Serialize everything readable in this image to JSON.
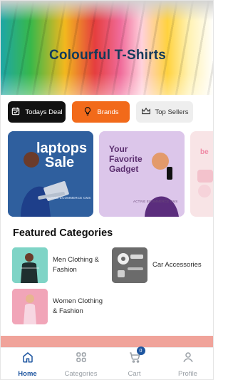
{
  "hero": {
    "title": "Colourful T-Shirts"
  },
  "chips": [
    {
      "label": "Todays Deal",
      "icon": "calendar-check-icon",
      "color": "#111111"
    },
    {
      "label": "Brands",
      "icon": "lightbulb-icon",
      "color": "#f26a1a"
    },
    {
      "label": "Top Sellers",
      "icon": "crown-icon",
      "color": "#eeeeee"
    }
  ],
  "banners": [
    {
      "line1": "laptops",
      "line2": "Sale",
      "small": "ACTIVE ECOMMERCE CMS"
    },
    {
      "line1": "Your",
      "line2": "Favorite",
      "line3": "Gadget",
      "small": "ACTIVE ECOMMERCE CMS"
    },
    {
      "line1": "be"
    }
  ],
  "featured": {
    "title": "Featured Categories",
    "items": [
      {
        "label": "Men Clothing & Fashion"
      },
      {
        "label": "Car Accessories"
      },
      {
        "label": "Women Clothing & Fashion"
      }
    ]
  },
  "bottom_nav": {
    "items": [
      {
        "label": "Home",
        "icon": "home-icon",
        "active": true
      },
      {
        "label": "Categories",
        "icon": "grid-icon",
        "active": false
      },
      {
        "label": "Cart",
        "icon": "cart-icon",
        "active": false,
        "badge": "0"
      },
      {
        "label": "Profile",
        "icon": "user-icon",
        "active": false
      }
    ]
  },
  "colors": {
    "accent": "#1e56a0",
    "brands_orange": "#f26a1a"
  }
}
